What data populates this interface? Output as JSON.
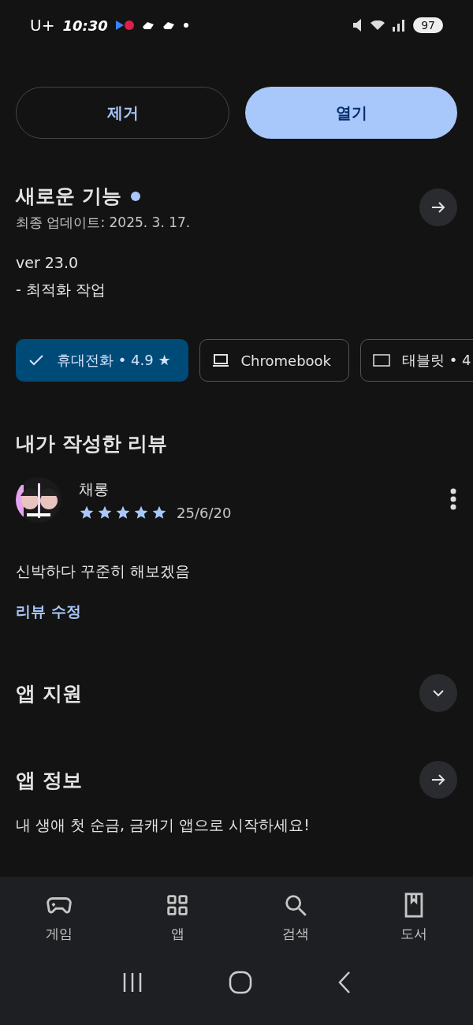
{
  "status_bar": {
    "carrier": "U+",
    "time": "10:30",
    "battery": "97"
  },
  "actions": [
    {
      "label": "제거",
      "kind": "outline"
    },
    {
      "label": "열기",
      "kind": "filled"
    }
  ],
  "whats_new": {
    "title": "새로운 기능",
    "updated": "최종 업데이트: 2025. 3. 17.",
    "lines": [
      "ver 23.0",
      "- 최적화 작업"
    ]
  },
  "devices": [
    {
      "label": "휴대전화 • 4.9 ★",
      "kind": "phone",
      "selected": true
    },
    {
      "label": "Chromebook",
      "kind": "laptop",
      "selected": false
    },
    {
      "label": "태블릿 • 4",
      "kind": "tablet",
      "selected": false
    }
  ],
  "my_review": {
    "heading": "내가 작성한 리뷰",
    "author": "채롱",
    "stars": 5,
    "date": "25/6/20",
    "text": "신박하다 꾸준히 해보겠음",
    "edit": "리뷰 수정"
  },
  "sections": [
    {
      "title": "앱 지원",
      "kind": "expand",
      "expanded": false
    },
    {
      "title": "앱 정보",
      "kind": "link",
      "description": "내 생애 첫 순금, 금캐기 앱으로 시작하세요!"
    }
  ],
  "bottom_nav": [
    {
      "label": "게임",
      "kind": "games"
    },
    {
      "label": "앱",
      "kind": "apps"
    },
    {
      "label": "검색",
      "kind": "search"
    },
    {
      "label": "도서",
      "kind": "books"
    }
  ]
}
